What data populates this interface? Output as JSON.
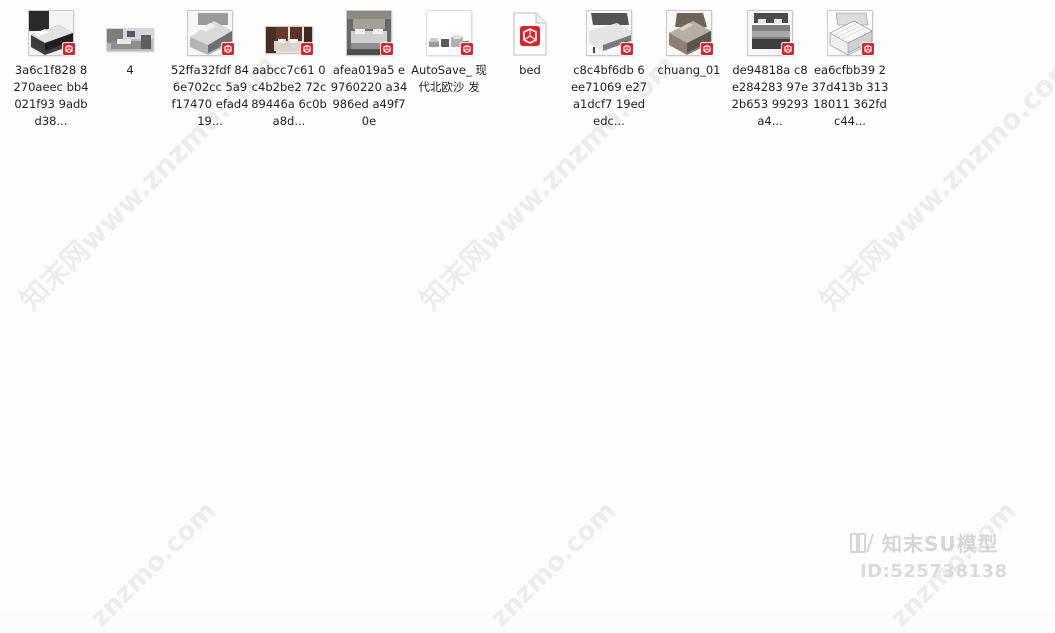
{
  "files": [
    {
      "label": "3a6c1f828 8270aeec bb4021f93 9adbd38...",
      "thumb": "dark-bed",
      "icon": "sketchup-file-icon"
    },
    {
      "label": "4",
      "thumb": "room-scene",
      "icon": "image-file-icon"
    },
    {
      "label": "52ffa32fdf 846e702cc 5a9f17470 efad419...",
      "thumb": "grey-bed",
      "icon": "sketchup-file-icon"
    },
    {
      "label": "aabcc7c61 0c4b2be2 72c89446a 6c0ba8d...",
      "thumb": "bed-brown-wall",
      "icon": "sketchup-file-icon"
    },
    {
      "label": "afea019a5 e9760220 a34986ed a49f70e",
      "thumb": "bed-grey-room",
      "icon": "sketchup-file-icon"
    },
    {
      "label": "AutoSave_ 现代北欧沙 发",
      "thumb": "sofa-set",
      "icon": "sketchup-file-icon"
    },
    {
      "label": "bed",
      "thumb": "sketchup-document",
      "icon": "sketchup-file-icon"
    },
    {
      "label": "c8c4bf6db 6ee71069 e27a1dcf7 19ededc...",
      "thumb": "white-bed",
      "icon": "sketchup-file-icon"
    },
    {
      "label": "chuang_01",
      "thumb": "beige-bed",
      "icon": "sketchup-file-icon"
    },
    {
      "label": "de94818a c8e284283 97e2b653 99293a4...",
      "thumb": "slate-bed",
      "icon": "sketchup-file-icon"
    },
    {
      "label": "ea6cfbb39 237d413b 31318011 362fdc44...",
      "thumb": "line-bed",
      "icon": "sketchup-file-icon"
    }
  ],
  "watermark": {
    "text": "知末网www.znzmo.com",
    "short": "znzmo.com",
    "brand_name": "知末SU模型",
    "brand_id": "ID:525738138"
  },
  "colors": {
    "sketchup_red": "#d8232a",
    "label_text": "#1e1e1e",
    "background": "#fdfdfd"
  }
}
